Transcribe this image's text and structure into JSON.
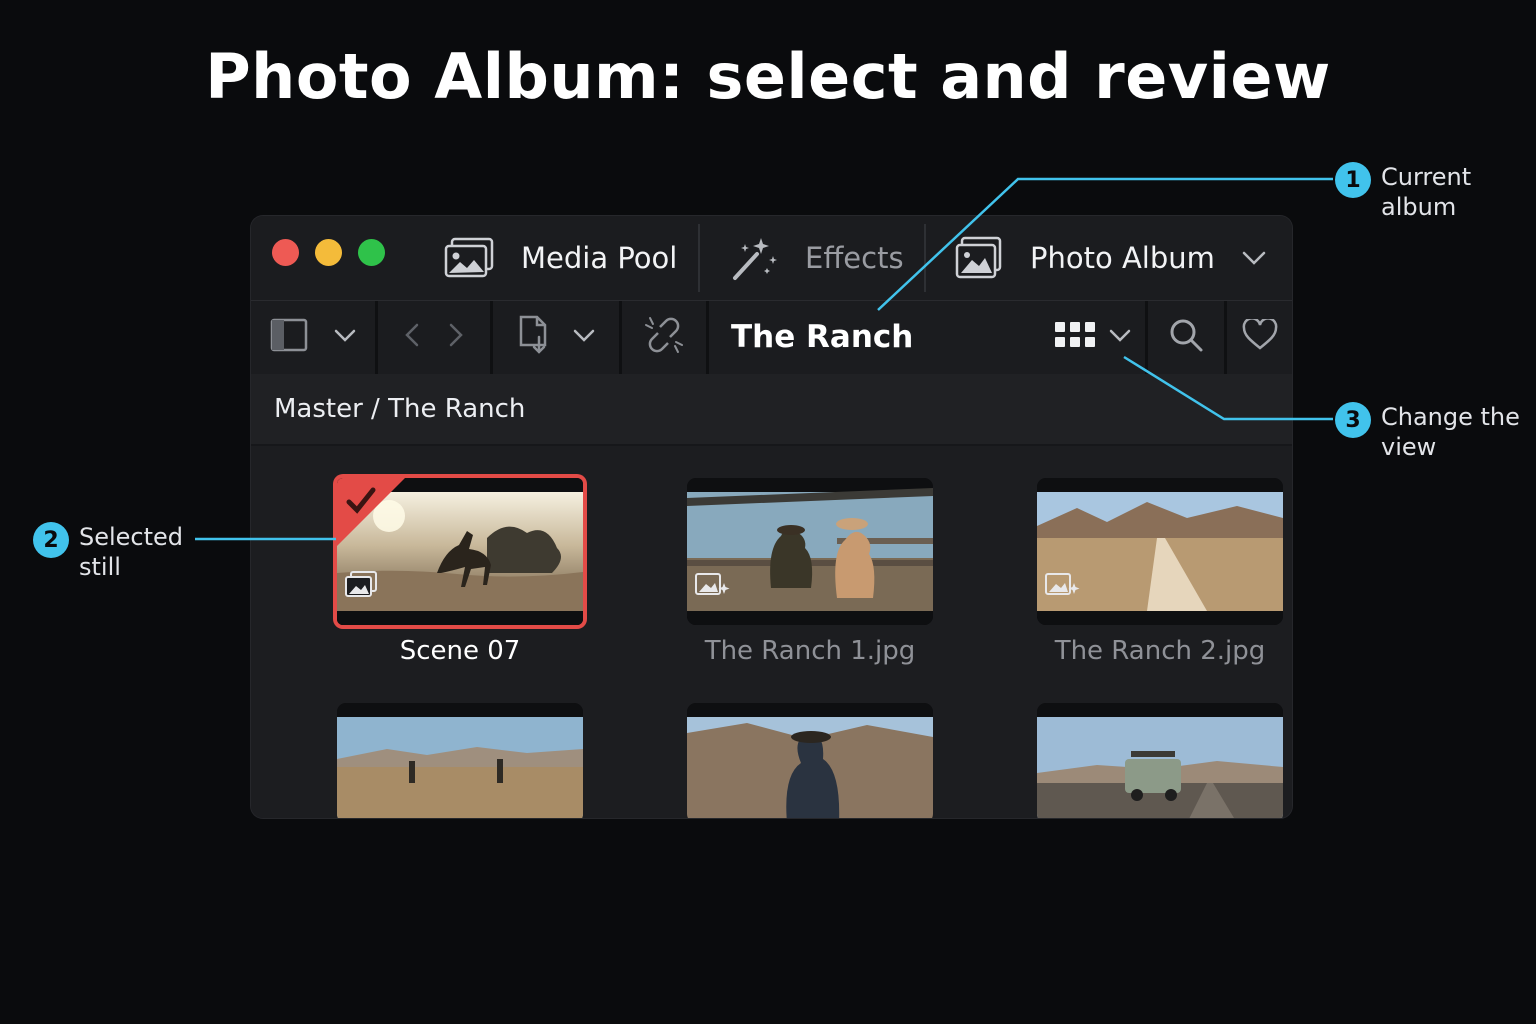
{
  "page_title": "Photo Album: select and review",
  "callouts": [
    {
      "num": "1",
      "text": "Current album"
    },
    {
      "num": "2",
      "text": "Selected still"
    },
    {
      "num": "3",
      "text": "Change the view"
    }
  ],
  "window": {
    "traffic_lights": [
      "#ee5a54",
      "#f4bb3a",
      "#2fc24a"
    ],
    "tabs": [
      {
        "label": "Media Pool",
        "icon": "image-stack-icon",
        "active": true
      },
      {
        "label": "Effects",
        "icon": "magic-wand-icon",
        "active": false
      },
      {
        "label": "Photo Album",
        "icon": "photo-album-icon",
        "active": true
      }
    ],
    "toolbar": {
      "album_name": "The Ranch",
      "icons": [
        "sidebar-toggle-icon",
        "chevron-down-icon",
        "back-arrow-icon",
        "forward-arrow-icon",
        "import-icon",
        "chevron-down-icon",
        "unlink-icon",
        "grid-view-icon",
        "chevron-down-icon",
        "search-icon",
        "heart-icon"
      ]
    },
    "breadcrumb": "Master / The Ranch",
    "stills": [
      {
        "caption": "Scene 07",
        "selected": true
      },
      {
        "caption": "The Ranch 1.jpg",
        "selected": false
      },
      {
        "caption": "The Ranch 2.jpg",
        "selected": false
      },
      {
        "caption": "",
        "selected": false
      },
      {
        "caption": "",
        "selected": false
      },
      {
        "caption": "",
        "selected": false
      }
    ]
  },
  "colors": {
    "accent": "#41c3ec",
    "selection": "#e34b47",
    "background": "#0a0b0d"
  }
}
